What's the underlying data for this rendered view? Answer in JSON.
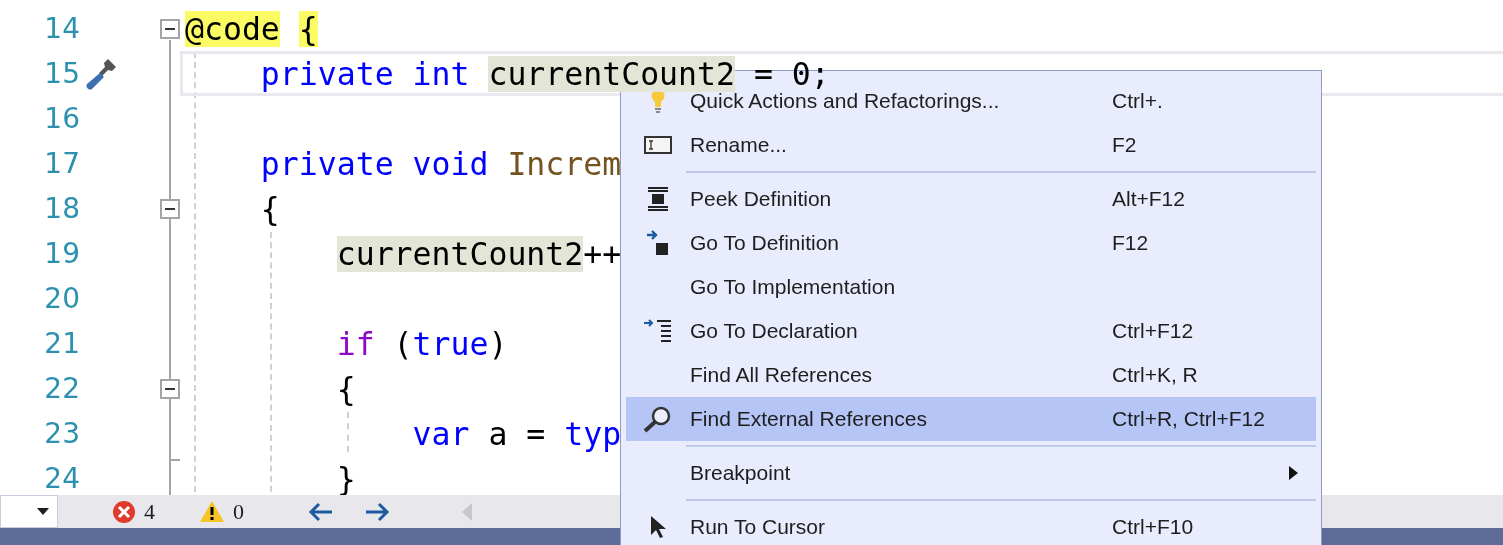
{
  "editor": {
    "lines": [
      {
        "number": "14",
        "foldable": true,
        "current": false,
        "tokens": [
          {
            "text": "@code",
            "kind": "brace_match"
          },
          {
            "text": "{",
            "kind": "brace_match"
          }
        ],
        "children": [
          {
            "number": "15",
            "foldable": false,
            "current": true,
            "tokens": [
              {
                "text": "private int ",
                "kind": "keyword"
              },
              {
                "text": "currentCount2",
                "kind": "reference"
              },
              {
                "text": " = 0;",
                "kind": "plain"
              }
            ]
          },
          {
            "number": "16",
            "foldable": false,
            "current": false
          },
          {
            "number": "17",
            "foldable": false,
            "current": false,
            "tokens": [
              {
                "text": "private void ",
                "kind": "keyword"
              },
              {
                "text": "Increm",
                "kind": "method"
              }
            ]
          },
          {
            "number": "18",
            "foldable": true,
            "current": false,
            "tokens": [
              {
                "text": "{",
                "kind": "plain"
              }
            ],
            "children": [
              {
                "number": "19",
                "foldable": false,
                "current": false,
                "tokens": [
                  {
                    "text": "currentCount2",
                    "kind": "reference"
                  },
                  {
                    "text": "++",
                    "kind": "plain"
                  }
                ]
              },
              {
                "number": "20",
                "foldable": false,
                "current": false
              },
              {
                "number": "21",
                "foldable": false,
                "current": false,
                "tokens": [
                  {
                    "text": "if",
                    "kind": "control"
                  },
                  {
                    "text": " (",
                    "kind": "plain"
                  },
                  {
                    "text": "true",
                    "kind": "keyword"
                  },
                  {
                    "text": ")",
                    "kind": "plain"
                  }
                ]
              },
              {
                "number": "22",
                "foldable": true,
                "current": false,
                "tokens": [
                  {
                    "text": "{",
                    "kind": "plain"
                  }
                ],
                "children": [
                  {
                    "number": "23",
                    "foldable": false,
                    "current": false,
                    "tokens": [
                      {
                        "text": "var",
                        "kind": "keyword"
                      },
                      {
                        "text": " a = ",
                        "kind": "plain"
                      },
                      {
                        "text": "typ",
                        "kind": "keyword"
                      }
                    ]
                  }
                ]
              },
              {
                "number": "24",
                "foldable": false,
                "current": false,
                "tokens": [
                  {
                    "text": "}",
                    "kind": "plain"
                  }
                ]
              }
            ]
          }
        ]
      }
    ]
  },
  "status_bar": {
    "errors": "4",
    "warnings": "0"
  },
  "context_menu": {
    "items": [
      {
        "kind": "item",
        "label": "Quick Actions and Refactorings...",
        "shortcut": "Ctrl+.",
        "selected": false
      },
      {
        "kind": "item",
        "label": "Rename...",
        "shortcut": "F2",
        "selected": false
      },
      {
        "kind": "separator"
      },
      {
        "kind": "item",
        "label": "Peek Definition",
        "shortcut": "Alt+F12",
        "selected": false
      },
      {
        "kind": "item",
        "label": "Go To Definition",
        "shortcut": "F12",
        "selected": false
      },
      {
        "kind": "item",
        "label": "Go To Implementation",
        "selected": false
      },
      {
        "kind": "item",
        "label": "Go To Declaration",
        "shortcut": "Ctrl+F12",
        "selected": false
      },
      {
        "kind": "item",
        "label": "Find All References",
        "shortcut": "Ctrl+K, R",
        "selected": false
      },
      {
        "kind": "item",
        "label": "Find External References",
        "shortcut": "Ctrl+R, Ctrl+F12",
        "selected": true
      },
      {
        "kind": "separator"
      },
      {
        "kind": "submenu",
        "label": "Breakpoint",
        "selected": false
      },
      {
        "kind": "separator"
      },
      {
        "kind": "item",
        "label": "Run To Cursor",
        "shortcut": "Ctrl+F10",
        "selected": false
      }
    ]
  }
}
